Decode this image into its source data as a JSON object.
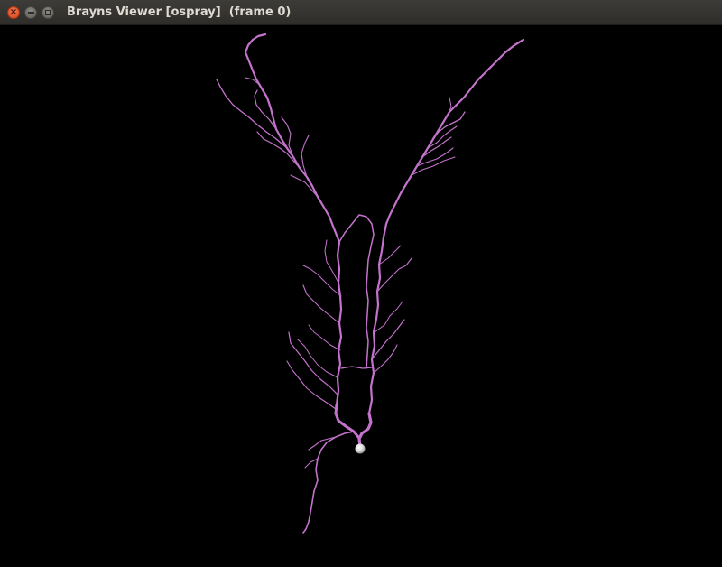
{
  "window": {
    "title": "Brayns Viewer [ospray]  (frame 0)",
    "controls": {
      "close_icon": "close-icon",
      "minimize_icon": "minimize-icon",
      "maximize_icon": "maximize-icon"
    }
  },
  "viewport": {
    "background_color": "#000000",
    "neuron_color": "#c373cc",
    "soma_color": "#e6e6e6",
    "subject": "neuron-morphology"
  }
}
